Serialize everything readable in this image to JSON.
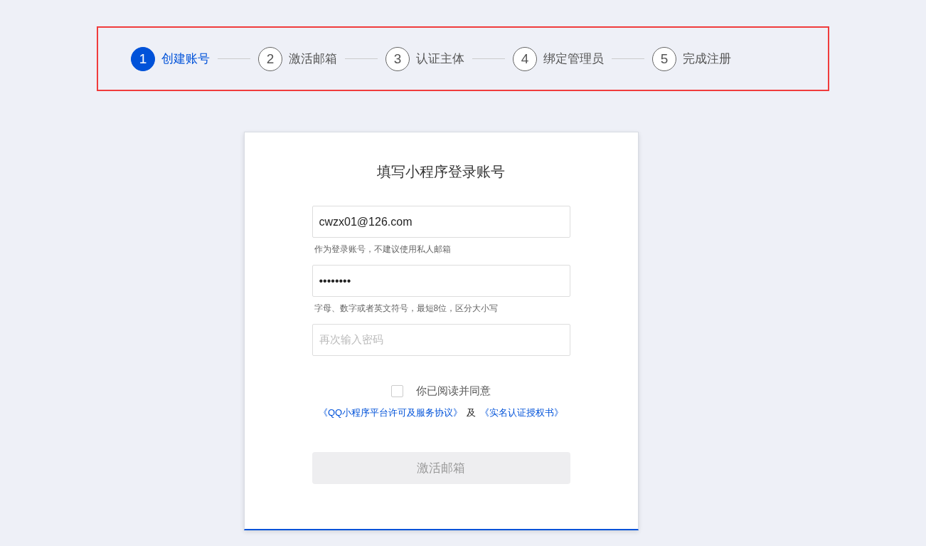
{
  "steps": [
    {
      "number": "1",
      "label": "创建账号",
      "selected": true
    },
    {
      "number": "2",
      "label": "激活邮箱",
      "selected": false
    },
    {
      "number": "3",
      "label": "认证主体",
      "selected": false
    },
    {
      "number": "4",
      "label": "绑定管理员",
      "selected": false
    },
    {
      "number": "5",
      "label": "完成注册",
      "selected": false
    }
  ],
  "form": {
    "title": "填写小程序登录账号",
    "fields": [
      {
        "value": "cwzx01@126.com",
        "hint": "作为登录账号，不建议使用私人邮箱"
      },
      {
        "value": "••••••••",
        "hint": "字母、数字或者英文符号，最短8位，区分大小写"
      },
      {
        "placeholder": "再次输入密码"
      }
    ],
    "agreement": {
      "checked": false,
      "label": "你已阅读并同意",
      "link_1": "《QQ小程序平台许可及服务协议》",
      "conjunction": "及",
      "link_2": "《实名认证授权书》"
    },
    "submit": {
      "label": "激活邮箱",
      "disabled": true
    }
  }
}
